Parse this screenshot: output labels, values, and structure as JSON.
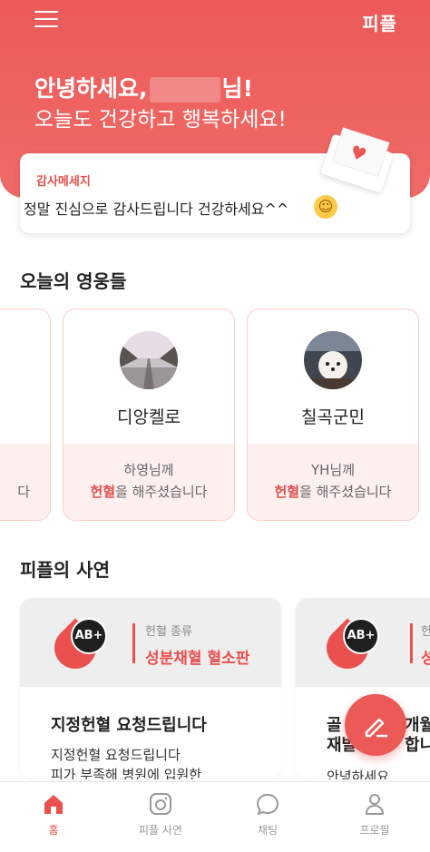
{
  "header": {
    "logo": "피플",
    "greeting_prefix": "안녕하세요,",
    "greeting_suffix": "님!",
    "greeting_line2": "오늘도 건강하고 행복하세요!"
  },
  "thanks_card": {
    "title": "감사메세지",
    "message": "정말 진심으로 감사드립니다 건강하세요^^",
    "emoji": "☺"
  },
  "heroes": {
    "section_title": "오늘의 영웅들",
    "cards": [
      {
        "name": "",
        "who": "",
        "action_highlight": "",
        "action_rest": "다"
      },
      {
        "name": "디앙켈로",
        "who": "하영님께",
        "action_highlight": "헌혈",
        "action_rest": "을 해주셨습니다"
      },
      {
        "name": "칠곡군민",
        "who": "YH님께",
        "action_highlight": "헌혈",
        "action_rest": "을 해주셨습니다"
      }
    ]
  },
  "stories": {
    "section_title": "피플의 사연",
    "cards": [
      {
        "blood_type": "AB+",
        "kind_label": "헌혈 종류",
        "kind_value": "성분채혈 혈소판",
        "title": "지정헌혈 요청드립니다",
        "body_line1": "지정헌혈 요청드립니다",
        "body_line2": "피가 부족해 병원에 입원한"
      },
      {
        "blood_type": "AB+",
        "kind_label": "헌",
        "kind_value": "성",
        "title_line1": "골",
        "title_line1_end": "개월",
        "title_line2": "재발",
        "title_line2_end": "합니",
        "body_line1": "안녕하세요"
      }
    ]
  },
  "tabbar": {
    "items": [
      {
        "label": "홈"
      },
      {
        "label": "피플 사연"
      },
      {
        "label": "채팅"
      },
      {
        "label": "프로필"
      }
    ]
  },
  "colors": {
    "primary": "#ec5a58",
    "card_bottom": "#fdf0ee",
    "story_top": "#eeeeee"
  }
}
